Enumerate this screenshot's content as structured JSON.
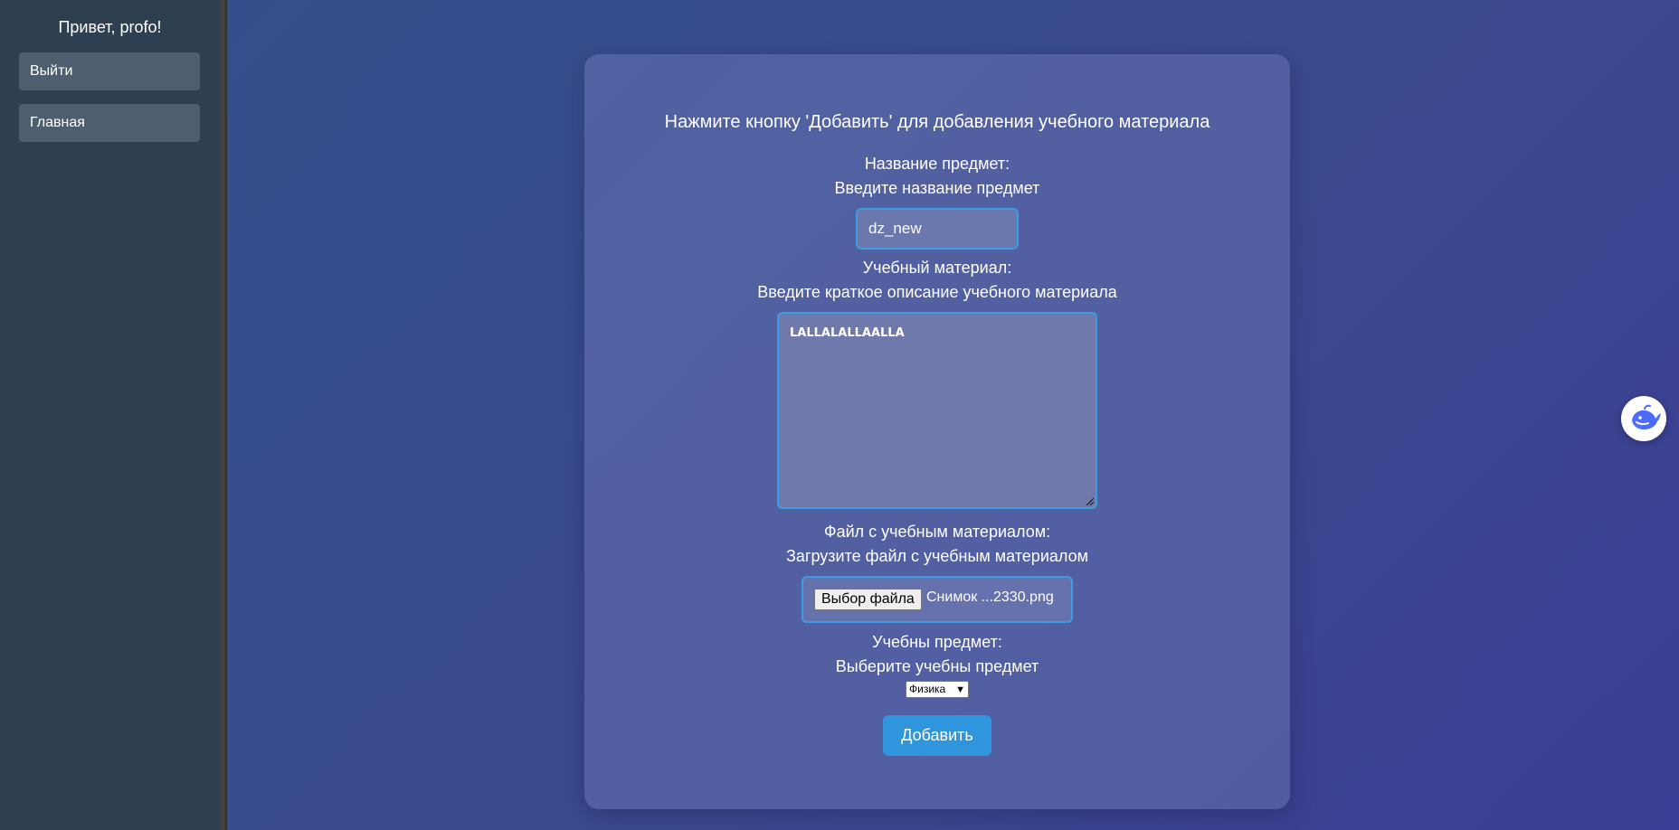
{
  "sidebar": {
    "greeting": "Привет, profo!",
    "items": [
      {
        "label": "Выйти"
      },
      {
        "label": "Главная"
      }
    ]
  },
  "form": {
    "title": "Нажмите кнопку 'Добавить' для добавления учебного материала",
    "subject_name": {
      "label": "Название предмет:",
      "hint": "Введите название предмет",
      "value": "dz_new"
    },
    "material": {
      "label": "Учебный материал:",
      "hint": "Введите краткое описание учебного материала",
      "value": "LALLALALLAALLA"
    },
    "file": {
      "label": "Файл с учебным материалом:",
      "hint": "Загрузите файл с учебным материалом",
      "button_label": "Выбор файла",
      "file_name": "Снимок ...2330.png"
    },
    "course": {
      "label": "Учебны предмет:",
      "hint": "Выберите учебны предмет",
      "selected": "Физика"
    },
    "submit_label": "Добавить"
  },
  "colors": {
    "accent": "#2f95dc",
    "input_border": "#3d9be0",
    "sidebar_bg": "#2e3f51"
  },
  "floating": {
    "icon": "whale-icon"
  }
}
